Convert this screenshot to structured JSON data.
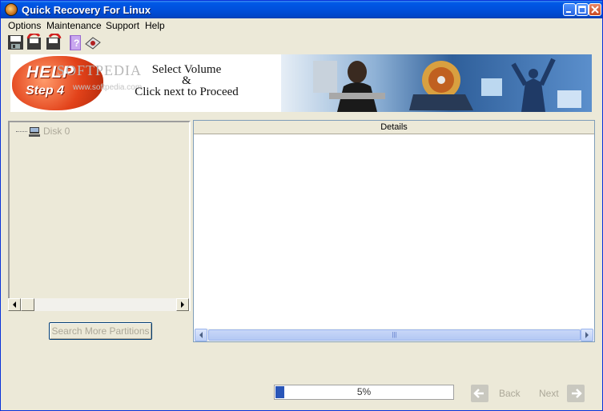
{
  "window": {
    "title": "Quick Recovery For Linux"
  },
  "menu": [
    "Options",
    "Maintenance",
    "Support",
    "Help"
  ],
  "toolbar_icons": [
    "save-icon",
    "restore-icon",
    "recover-icon",
    "help-book-icon",
    "disk-tool-icon"
  ],
  "banner": {
    "badge_line1": "HELP",
    "badge_line2": "Step 4",
    "watermark": "SOFTPEDIA",
    "watermark_sub": "www.softpedia.com",
    "instruction_line1": "Select Volume",
    "instruction_line2": "&",
    "instruction_line3": "Click next to Proceed"
  },
  "tree": {
    "items": [
      {
        "label": "Disk 0",
        "icon": "disk-icon"
      }
    ]
  },
  "search_button": "Search More Partitions",
  "details": {
    "header": "Details"
  },
  "progress": {
    "percent": 5,
    "label": "5%"
  },
  "nav": {
    "back_label": "Back",
    "next_label": "Next"
  },
  "colors": {
    "titlebar": "#0054E3",
    "window_bg": "#ECE9D8",
    "progress_fill": "#2A56B8",
    "disabled_text": "#ACA899"
  }
}
